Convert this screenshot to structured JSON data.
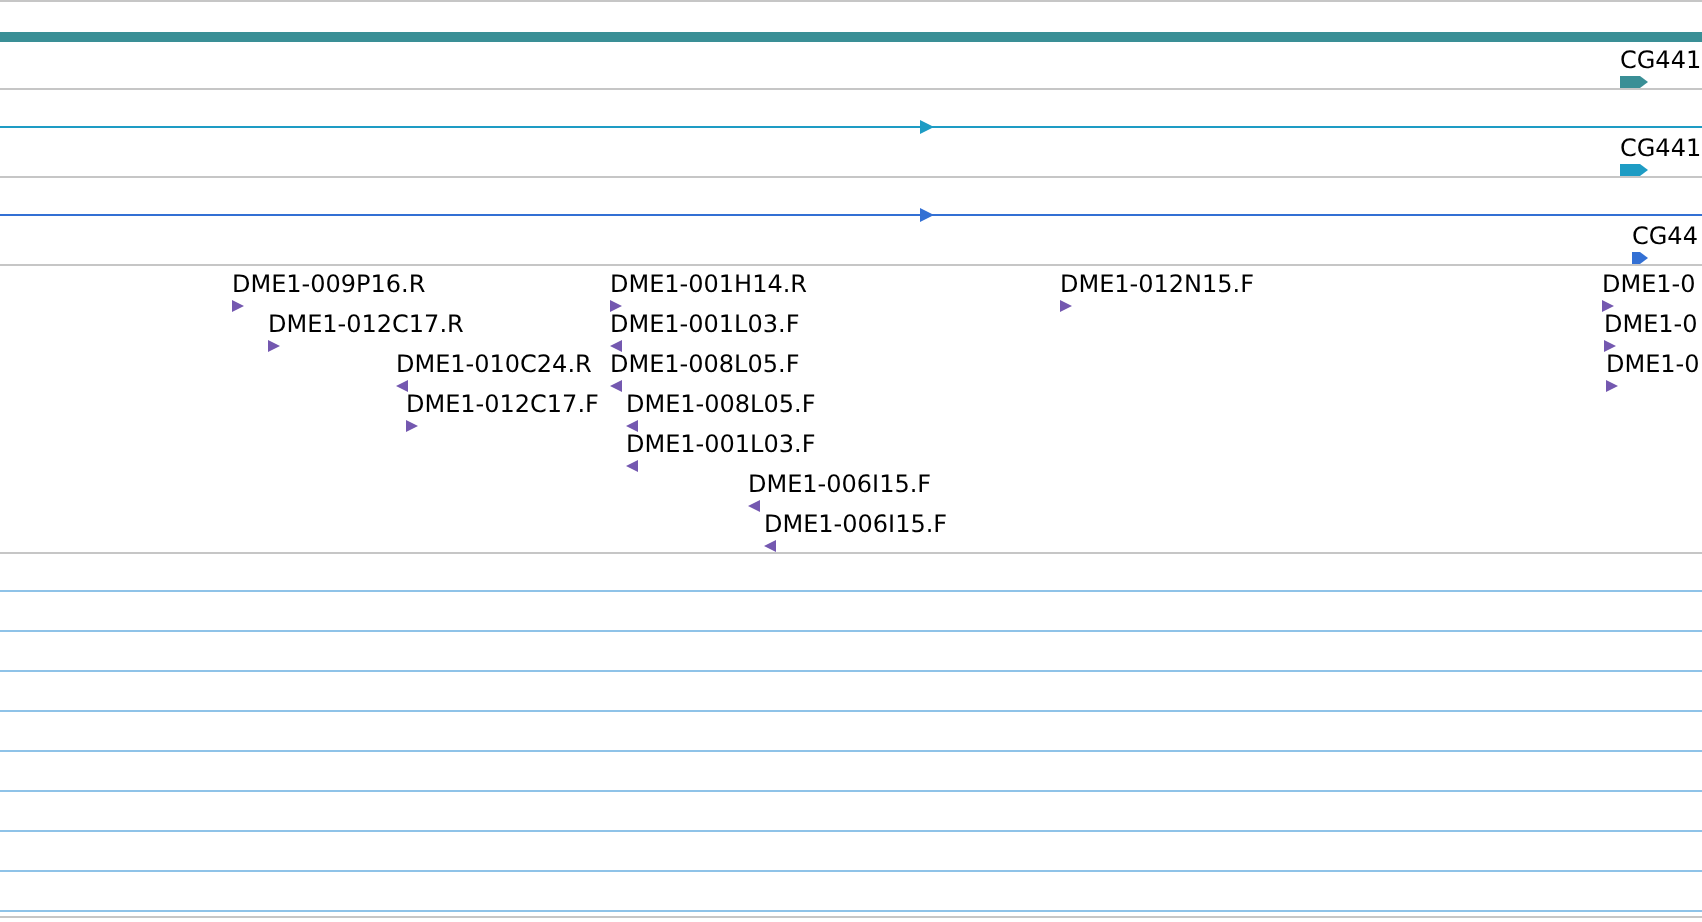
{
  "gene_tracks": [
    {
      "label": "CG441",
      "kind": "bar",
      "color": "#3a8f96"
    },
    {
      "label": "CG441",
      "kind": "line",
      "color": "#1e9cc4"
    },
    {
      "label": "CG44",
      "kind": "line",
      "color": "#3370d4"
    }
  ],
  "features": [
    {
      "label": "DME1-009P16.R",
      "reverse": false
    },
    {
      "label": "DME1-012C17.R",
      "reverse": false
    },
    {
      "label": "DME1-010C24.R",
      "reverse": true
    },
    {
      "label": "DME1-012C17.F",
      "reverse": false
    },
    {
      "label": "DME1-001H14.R",
      "reverse": false
    },
    {
      "label": "DME1-001L03.F",
      "reverse": true
    },
    {
      "label": "DME1-008L05.F",
      "reverse": true
    },
    {
      "label": "DME1-008L05.F",
      "reverse": true
    },
    {
      "label": "DME1-001L03.F",
      "reverse": true
    },
    {
      "label": "DME1-006I15.F",
      "reverse": true
    },
    {
      "label": "DME1-006I15.F",
      "reverse": true
    },
    {
      "label": "DME1-012N15.F",
      "reverse": false
    },
    {
      "label": "DME1-0",
      "reverse": false
    },
    {
      "label": "DME1-0",
      "reverse": false
    },
    {
      "label": "DME1-0",
      "reverse": false
    }
  ]
}
